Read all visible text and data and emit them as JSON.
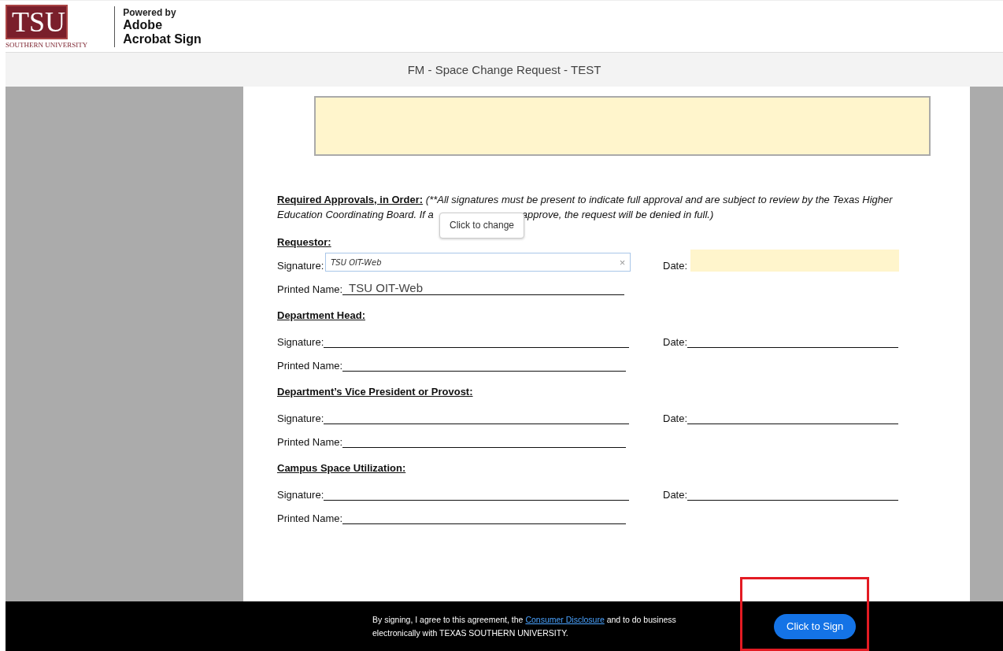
{
  "header": {
    "logo_letters": "TSU",
    "logo_caption": "SOUTHERN UNIVERSITY",
    "powered_by": "Powered by",
    "product_lines": [
      "Adobe",
      "Acrobat Sign"
    ]
  },
  "document_title": "FM - Space Change Request - TEST",
  "document": {
    "approvals_heading": "Required Approvals, in Order:",
    "approvals_line1": "(**All signatures must be present to indicate full approval and are subject to review by the Texas Higher",
    "approvals_line2_start": "Education Coordinating Board. If a",
    "approvals_line2_end": "approve, the request will be denied in full.)",
    "tooltip": "Click to change",
    "sections": [
      {
        "title": "Requestor:",
        "signature_label": "Signature:",
        "signature_value": "TSU OIT-Web",
        "clear_symbol": "×",
        "date_label": "Date:",
        "date_field": true,
        "printed_name_label": "Printed Name:",
        "printed_name_value": "TSU OIT-Web"
      },
      {
        "title": "Department Head:",
        "signature_label": "Signature:",
        "date_label": "Date:",
        "date_field": false,
        "printed_name_label": "Printed Name:"
      },
      {
        "title": "Department’s Vice President or Provost:",
        "signature_label": "Signature:",
        "date_label": "Date:",
        "date_field": false,
        "printed_name_label": "Printed Name:"
      },
      {
        "title": "Campus Space Utilization:",
        "signature_label": "Signature:",
        "date_label": "Date:",
        "date_field": false,
        "printed_name_label": "Printed Name:"
      }
    ]
  },
  "footer": {
    "text_before": "By signing, I agree to this agreement, the ",
    "link": "Consumer Disclosure",
    "text_after": " and to do business electronically with TEXAS SOUTHERN UNIVERSITY.",
    "button": "Click to Sign"
  }
}
